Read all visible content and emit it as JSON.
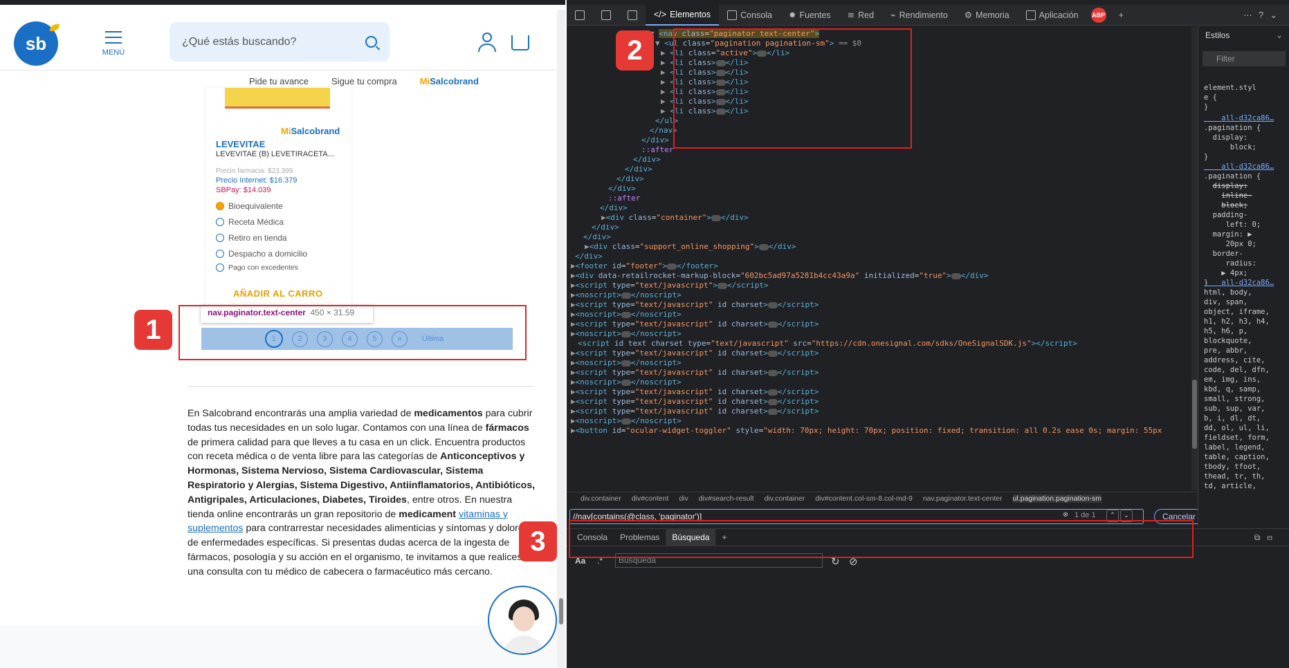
{
  "shop": {
    "logo_text": "sb",
    "menu_label": "MENÚ",
    "search_placeholder": "¿Qué estás buscando?",
    "subnav": [
      "Pide tu avance",
      "Sigue tu compra",
      "Mi",
      "Salcobrand"
    ],
    "product": {
      "brand_badge_a": "Mi",
      "brand_badge_b": "Salcobrand",
      "name": "LEVEVITAE",
      "desc": "LEVEVITAE (B) LEVETIRACETA...",
      "price_farmacia": "Precio farmacia: $23.399",
      "price_internet": "Precio Internet: $16.379",
      "price_sbpay": "SBPay: $14.039",
      "features": [
        "Bioequivalente",
        "Receta Médica",
        "Retiro en tienda",
        "Despacho a domicilio",
        "Pago con excedentes"
      ],
      "add_to_cart": "AÑADIR AL CARRO"
    },
    "tooltip": {
      "selector": "nav.paginator.text-center",
      "size": "450 × 31.59"
    },
    "pagination": [
      "1",
      "2",
      "3",
      "4",
      "5",
      "»",
      "Última"
    ],
    "paragraph": {
      "p1": "En Salcobrand encontrarás una amplia variedad de ",
      "b1": "medicamentos",
      "p2": " para cubrir todas tus necesidades en un solo lugar. Contamos con una línea de ",
      "b2": "fármacos",
      "p3": " de primera calidad para que lleves a tu casa en un click. Encuentra productos con receta médica o de venta libre para las categorías de ",
      "b3": "Anticonceptivos y Hormonas, Sistema Nervioso, Sistema Cardiovascular, Sistema Respiratorio y Alergias, Sistema Digestivo, Antiinflamatorios, Antibióticos, Antigripales, Articulaciones, Diabetes, Tiroides",
      "p4": ", entre otros. En nuestra tienda online encontrarás un gran repositorio de ",
      "b4": "medicament",
      "p5": " ",
      "link": "vitaminas y suplementos",
      "p6": " para contrarrestar necesidades alimenticias y síntomas y dolores de enfermedades específicas. Si presentas dudas acerca de la ingesta de fármacos, posología y su acción en el organismo, te invitamos a que realices una consulta con tu médico de cabecera o farmacéutico más cercano."
    }
  },
  "badges": [
    "1",
    "2",
    "3"
  ],
  "devtools": {
    "tabs": [
      "Elementos",
      "Consola",
      "Fuentes",
      "Red",
      "Rendimiento",
      "Memoria",
      "Aplicación"
    ],
    "abp": "ABP",
    "styles_tab": "Estilos",
    "filter_placeholder": "Filter",
    "find_query": "//nav[contains(@class, 'paginator')]",
    "find_count": "1 de 1",
    "cancel": "Cancelar",
    "drawer_tabs": [
      "Consola",
      "Problemas",
      "Búsqueda"
    ],
    "drawer_aa": "Aa",
    "drawer_search_placeholder": "Búsqueda",
    "breadcrumbs": [
      "div.container",
      "div#content",
      "div",
      "div#search-result",
      "div.container",
      "div#content.col-sm-8.col-md-9",
      "nav.paginator.text-center",
      "ul.pagination.pagination-sm"
    ]
  }
}
